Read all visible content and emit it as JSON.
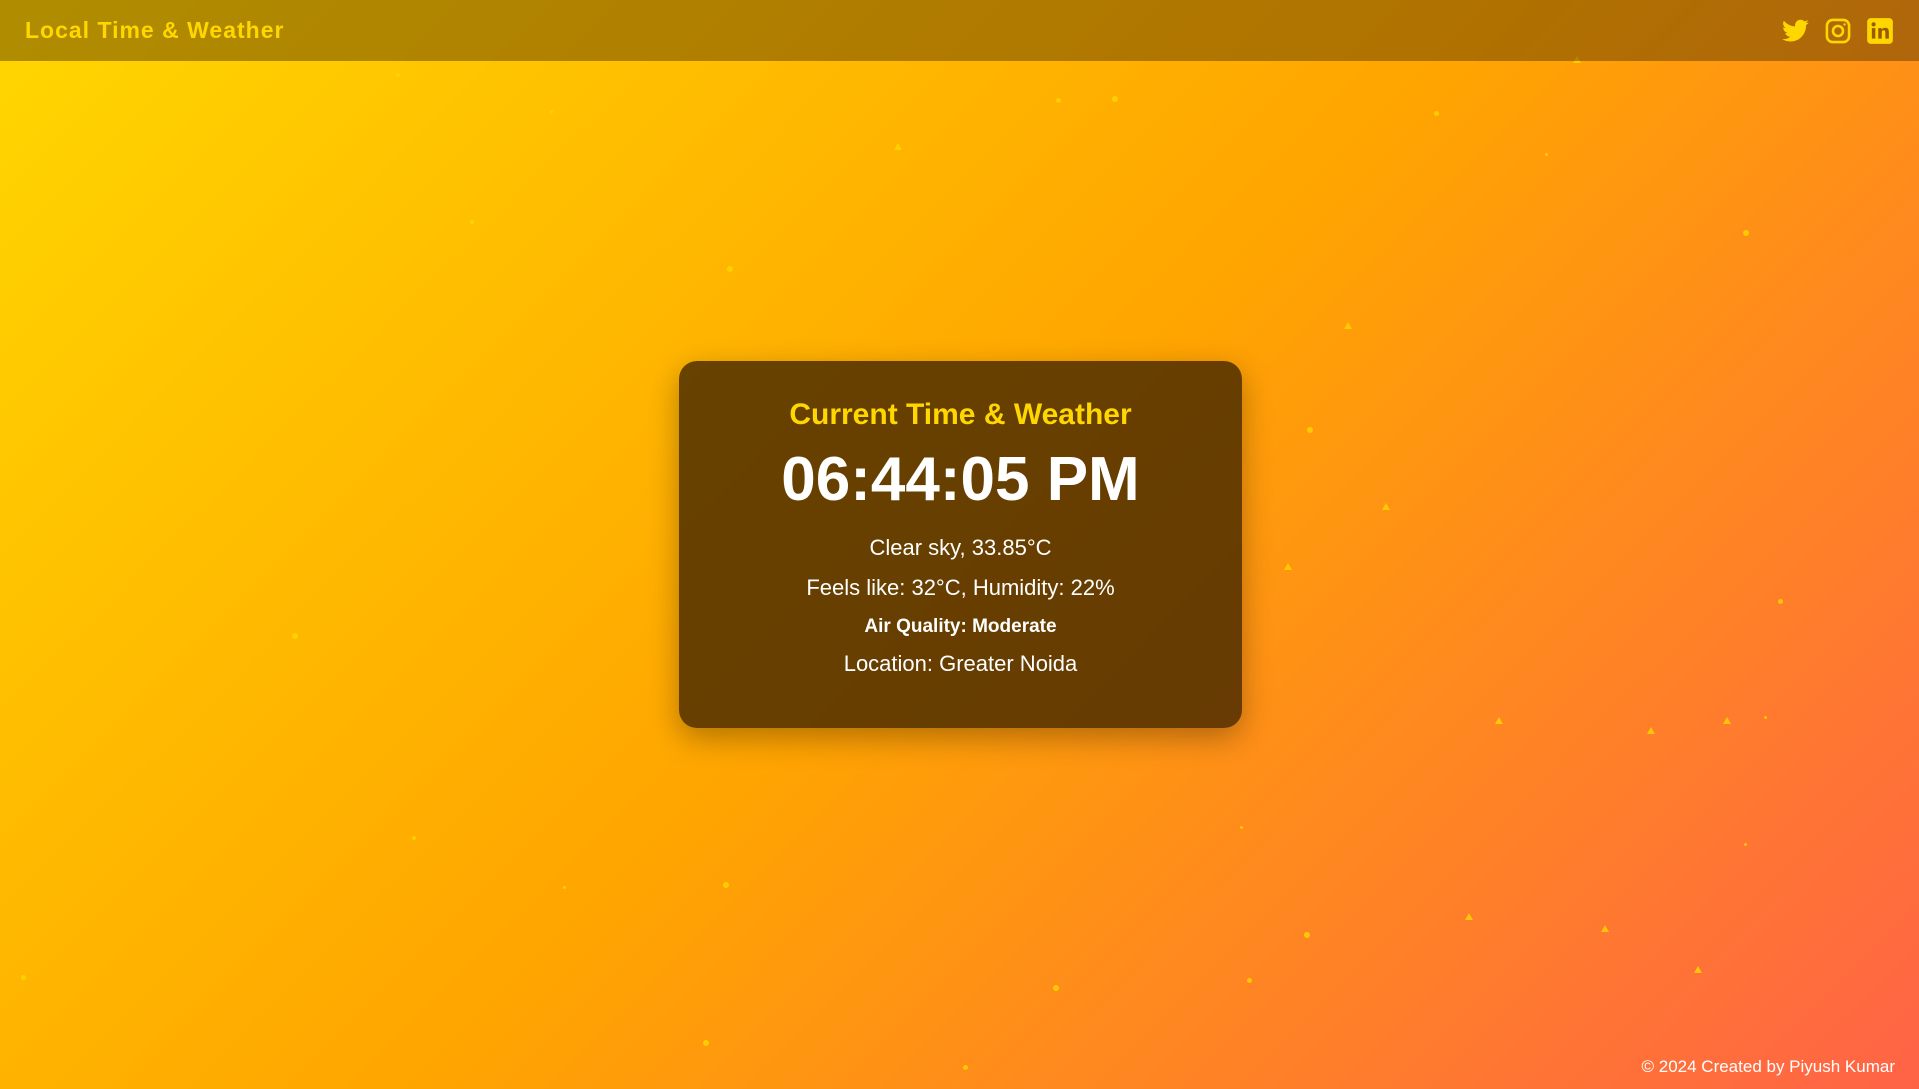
{
  "header": {
    "brand": "Local Time & Weather",
    "social": [
      {
        "name": "twitter-icon"
      },
      {
        "name": "instagram-icon"
      },
      {
        "name": "linkedin-icon"
      }
    ]
  },
  "card": {
    "title": "Current Time & Weather",
    "time": "06:44:05 PM",
    "conditions": "Clear sky, 33.85°C",
    "feels": "Feels like: 32°C, Humidity: 22%",
    "air_quality": "Air Quality: Moderate",
    "location": "Location: Greater Noida"
  },
  "footer": {
    "text": "© 2024 Created by Piyush Kumar"
  },
  "colors": {
    "accent": "#FFD700",
    "gradient_start": "#FFD700",
    "gradient_mid": "#FFA500",
    "gradient_end": "#FF6347"
  }
}
